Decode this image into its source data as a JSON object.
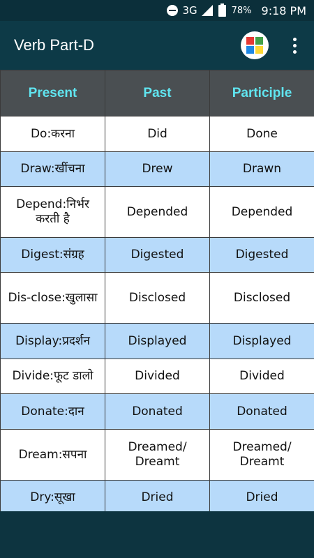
{
  "status": {
    "network": "3G",
    "battery": "78%",
    "time": "9:18 PM"
  },
  "appbar": {
    "title": "Verb Part-D",
    "logo_colors": [
      "#e53935",
      "#43a047",
      "#1e88e5",
      "#fdd835"
    ]
  },
  "table": {
    "headers": [
      "Present",
      "Past",
      "Participle"
    ],
    "rows": [
      {
        "present": "Do:करना",
        "past": "Did",
        "participle": "Done"
      },
      {
        "present": "Draw:खींचना",
        "past": "Drew",
        "participle": "Drawn"
      },
      {
        "present": "Depend:निर्भर करती है",
        "past": "Depended",
        "participle": "Depended"
      },
      {
        "present": "Digest:संग्रह",
        "past": "Digested",
        "participle": "Digested"
      },
      {
        "present": "Dis-close:खुलासा",
        "past": "Disclosed",
        "participle": "Disclosed"
      },
      {
        "present": "Display:प्रदर्शन",
        "past": "Displayed",
        "participle": "Displayed"
      },
      {
        "present": "Divide:फूट डालो",
        "past": "Divided",
        "participle": "Divided"
      },
      {
        "present": "Donate:दान",
        "past": "Donated",
        "participle": "Donated"
      },
      {
        "present": "Dream:सपना",
        "past": "Dreamed/ Dreamt",
        "participle": "Dreamed/ Dreamt"
      },
      {
        "present": "Dry:सूखा",
        "past": "Dried",
        "participle": "Dried"
      }
    ]
  }
}
